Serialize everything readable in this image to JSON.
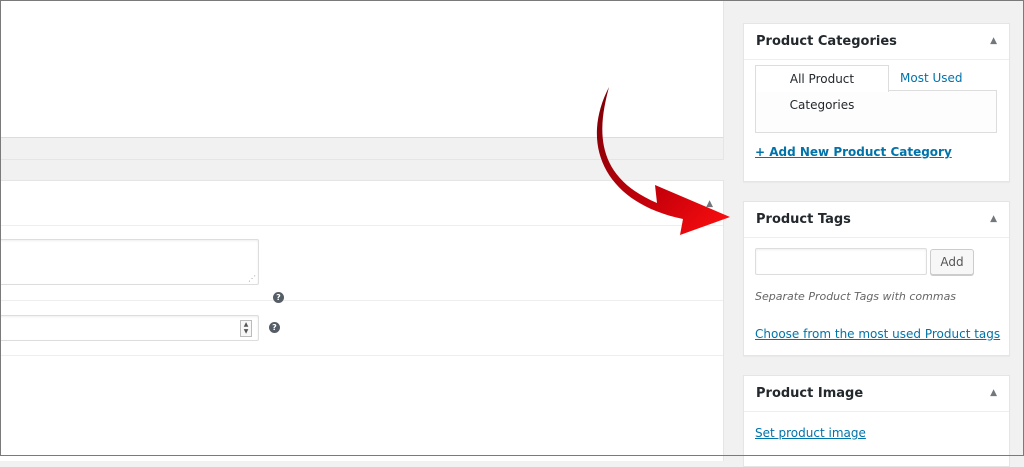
{
  "editor": {
    "help_icon_glyph": "?"
  },
  "sidebar": {
    "categories": {
      "title": "Product Categories",
      "tabs": [
        {
          "label": "All Product Categories",
          "active": true
        },
        {
          "label": "Most Used",
          "active": false
        }
      ],
      "add_new_label": "+ Add New Product Category"
    },
    "tags": {
      "title": "Product Tags",
      "input_value": "",
      "add_button_label": "Add",
      "howto_text": "Separate Product Tags with commas",
      "choose_link": "Choose from the most used Product tags"
    },
    "image": {
      "title": "Product Image",
      "set_link": "Set product image"
    }
  },
  "annotation": {
    "arrow_color": "#c8000a",
    "icon": "curved-arrow-icon"
  },
  "colors": {
    "link": "#0073aa",
    "background": "#f1f1f1"
  }
}
